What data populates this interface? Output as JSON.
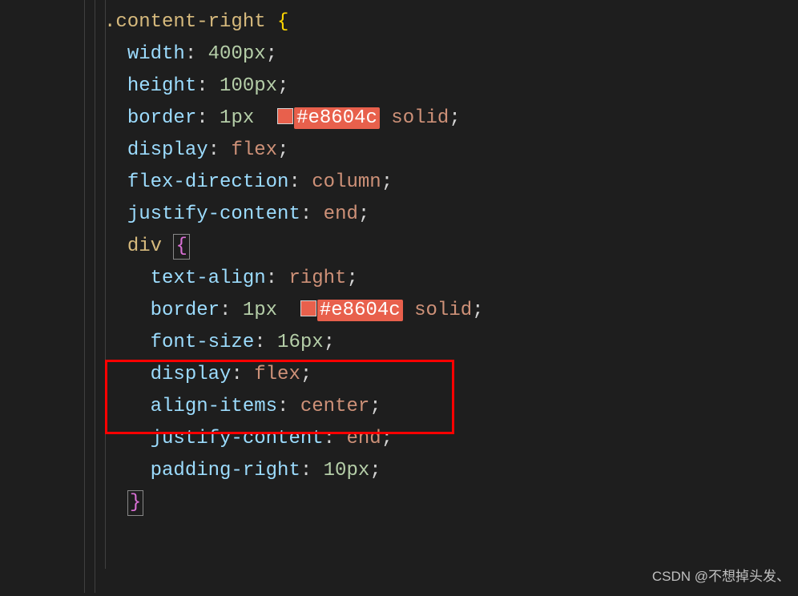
{
  "code": {
    "selector": ".content-right",
    "open_brace": "{",
    "close_brace": "}",
    "rules": {
      "width": {
        "prop": "width",
        "colon": ":",
        "val": " 400",
        "unit": "px",
        "semi": ";"
      },
      "height": {
        "prop": "height",
        "colon": ":",
        "val": " 100",
        "unit": "px",
        "semi": ";"
      },
      "border": {
        "prop": "border",
        "colon": ":",
        "val1": " 1",
        "unit1": "px",
        "hex": "#e8604c",
        "val2": " solid",
        "semi": ";"
      },
      "display": {
        "prop": "display",
        "colon": ":",
        "val": " flex",
        "semi": ";"
      },
      "flexdir": {
        "prop": "flex-direction",
        "colon": ":",
        "val": " column",
        "semi": ";"
      },
      "justify": {
        "prop": "justify-content",
        "colon": ":",
        "val": " end",
        "semi": ";"
      }
    },
    "nested": {
      "selector": "div",
      "open_brace": "{",
      "close_brace": "}",
      "rules": {
        "textalign": {
          "prop": "text-align",
          "colon": ":",
          "val": " right",
          "semi": ";"
        },
        "border": {
          "prop": "border",
          "colon": ":",
          "val1": " 1",
          "unit1": "px",
          "hex": "#e8604c",
          "val2": " solid",
          "semi": ";"
        },
        "fontsize": {
          "prop": "font-size",
          "colon": ":",
          "val": " 16",
          "unit": "px",
          "semi": ";"
        },
        "display": {
          "prop": "display",
          "colon": ":",
          "val": " flex",
          "semi": ";"
        },
        "alignitems": {
          "prop": "align-items",
          "colon": ":",
          "val": " center",
          "semi": ";"
        },
        "justify": {
          "prop": "justify-content",
          "colon": ":",
          "val": " end",
          "semi": ";"
        },
        "padright": {
          "prop": "padding-right",
          "colon": ":",
          "val": " 10",
          "unit": "px",
          "semi": ";"
        }
      }
    }
  },
  "watermark": "CSDN @不想掉头发、",
  "swatch_color": "#e8604c"
}
